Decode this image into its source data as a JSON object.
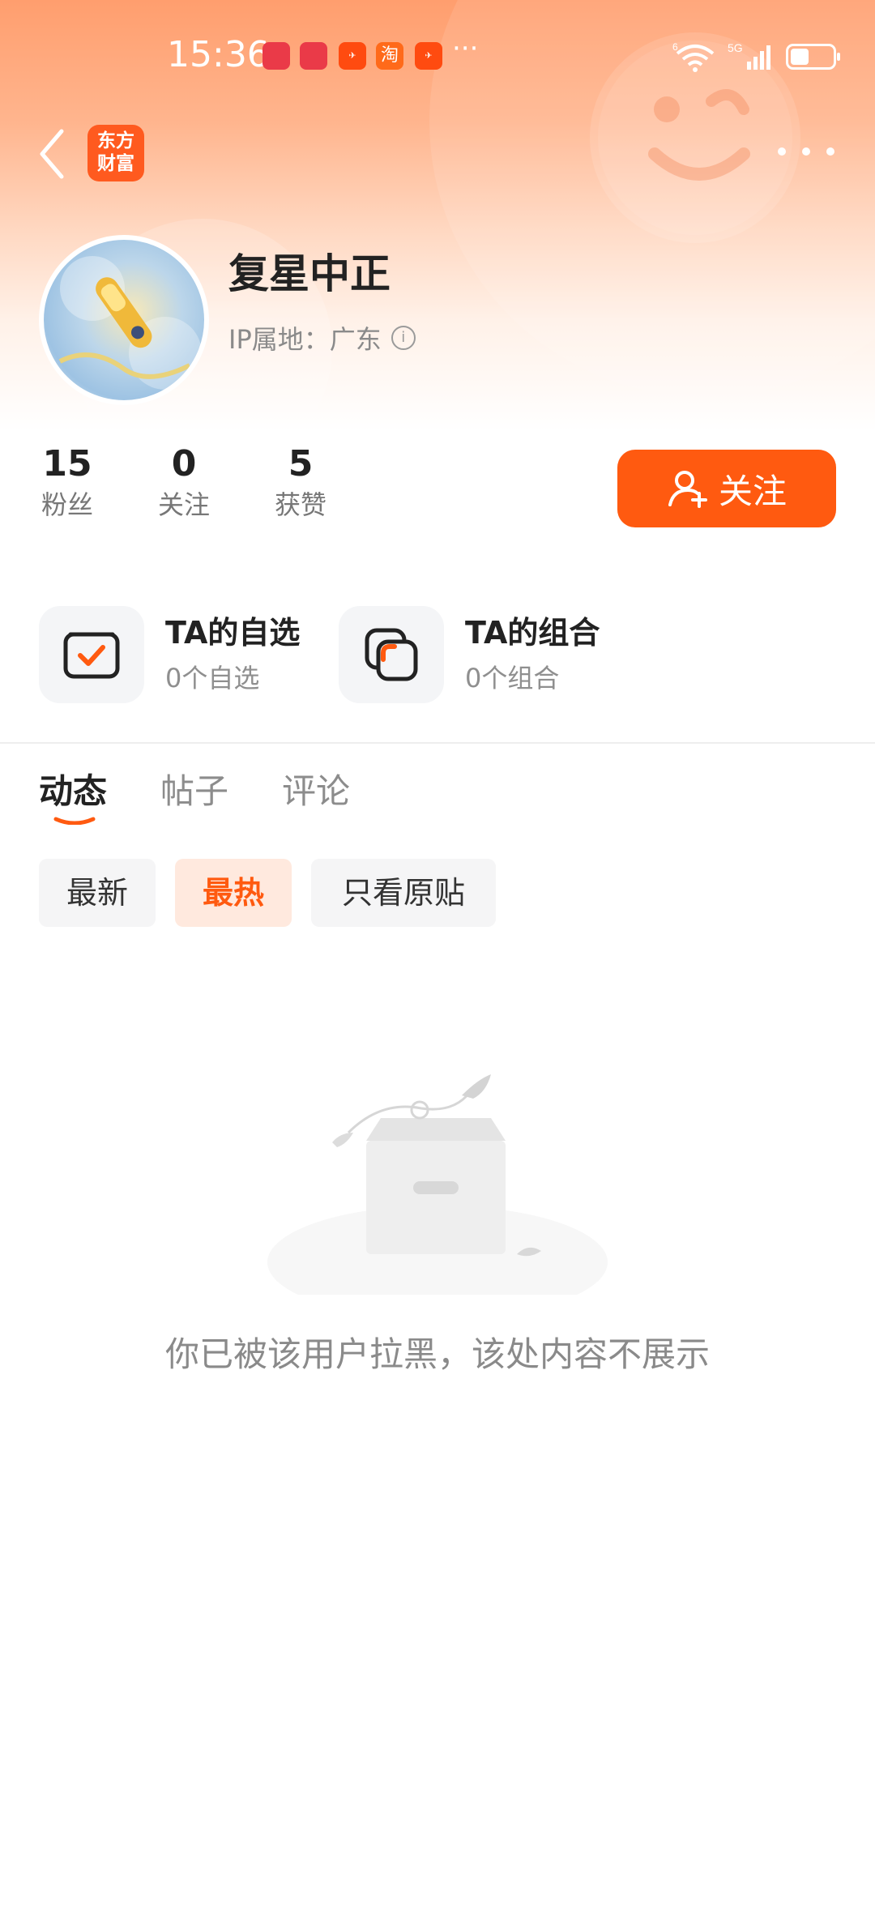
{
  "status_bar": {
    "time": "15:36",
    "notifications": [
      "huawei-app-icon",
      "huawei-app-icon",
      "plane-app-icon",
      "淘",
      "plane-app-icon"
    ],
    "more": "···",
    "network": "5G",
    "wifi_badge": "6"
  },
  "nav": {
    "logo_text": "东方\n财富"
  },
  "profile": {
    "name": "复星中正",
    "ip_location": "IP属地：广东",
    "stats": [
      {
        "value": "15",
        "label": "粉丝"
      },
      {
        "value": "0",
        "label": "关注"
      },
      {
        "value": "5",
        "label": "获赞"
      }
    ],
    "follow_label": "关注"
  },
  "features": [
    {
      "title": "TA的自选",
      "subtitle": "0个自选"
    },
    {
      "title": "TA的组合",
      "subtitle": "0个组合"
    }
  ],
  "tabs": [
    {
      "label": "动态",
      "active": true
    },
    {
      "label": "帖子",
      "active": false
    },
    {
      "label": "评论",
      "active": false
    }
  ],
  "filters": [
    {
      "label": "最新",
      "active": false
    },
    {
      "label": "最热",
      "active": true
    },
    {
      "label": "只看原贴",
      "active": false
    }
  ],
  "empty_message": "你已被该用户拉黑，该处内容不展示",
  "colors": {
    "accent": "#ff5a10",
    "header_gradient_top": "#ff9e6e",
    "muted_text": "#8a8a8a"
  }
}
